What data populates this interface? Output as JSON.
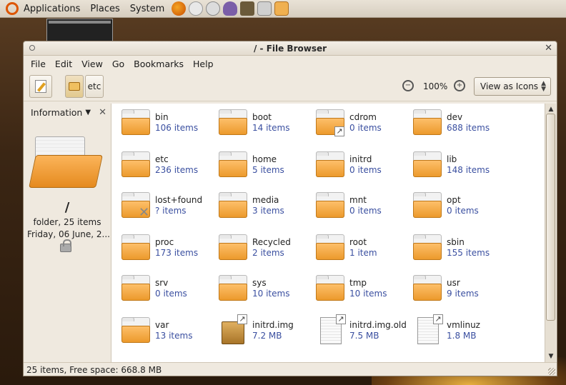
{
  "panel": {
    "menus": [
      "Applications",
      "Places",
      "System"
    ],
    "launchers": [
      "firefox-icon",
      "mail-icon",
      "help-icon",
      "pidgin-icon",
      "gimp-icon",
      "download-icon",
      "folder-icon"
    ]
  },
  "window": {
    "title": "/ - File Browser",
    "menubar": [
      "File",
      "Edit",
      "View",
      "Go",
      "Bookmarks",
      "Help"
    ],
    "toolbar": {
      "path_buttons": [
        "etc"
      ],
      "zoom_level": "100%",
      "view_mode": "View as Icons"
    },
    "sidepane": {
      "header": "Information",
      "name": "/",
      "info": "folder, 25 items",
      "date": "Friday, 06 June, 2..."
    },
    "items": [
      {
        "name": "bin",
        "detail": "106 items",
        "kind": "folder"
      },
      {
        "name": "boot",
        "detail": "14 items",
        "kind": "folder"
      },
      {
        "name": "cdrom",
        "detail": "0 items",
        "kind": "folder-link"
      },
      {
        "name": "dev",
        "detail": "688 items",
        "kind": "folder"
      },
      {
        "name": "etc",
        "detail": "236 items",
        "kind": "folder"
      },
      {
        "name": "home",
        "detail": "5 items",
        "kind": "folder"
      },
      {
        "name": "initrd",
        "detail": "0 items",
        "kind": "folder"
      },
      {
        "name": "lib",
        "detail": "148 items",
        "kind": "folder"
      },
      {
        "name": "lost+found",
        "detail": "? items",
        "kind": "folder-locked"
      },
      {
        "name": "media",
        "detail": "3 items",
        "kind": "folder"
      },
      {
        "name": "mnt",
        "detail": "0 items",
        "kind": "folder"
      },
      {
        "name": "opt",
        "detail": "0 items",
        "kind": "folder"
      },
      {
        "name": "proc",
        "detail": "173 items",
        "kind": "folder"
      },
      {
        "name": "Recycled",
        "detail": "2 items",
        "kind": "folder"
      },
      {
        "name": "root",
        "detail": "1 item",
        "kind": "folder"
      },
      {
        "name": "sbin",
        "detail": "155 items",
        "kind": "folder"
      },
      {
        "name": "srv",
        "detail": "0 items",
        "kind": "folder"
      },
      {
        "name": "sys",
        "detail": "10 items",
        "kind": "folder"
      },
      {
        "name": "tmp",
        "detail": "10 items",
        "kind": "folder"
      },
      {
        "name": "usr",
        "detail": "9 items",
        "kind": "folder"
      },
      {
        "name": "var",
        "detail": "13 items",
        "kind": "folder"
      },
      {
        "name": "initrd.img",
        "detail": "7.2 MB",
        "kind": "package-link"
      },
      {
        "name": "initrd.img.old",
        "detail": "7.5 MB",
        "kind": "file-link"
      },
      {
        "name": "vmlinuz",
        "detail": "1.8 MB",
        "kind": "file-link"
      }
    ],
    "status": "25 items, Free space: 668.8 MB"
  }
}
